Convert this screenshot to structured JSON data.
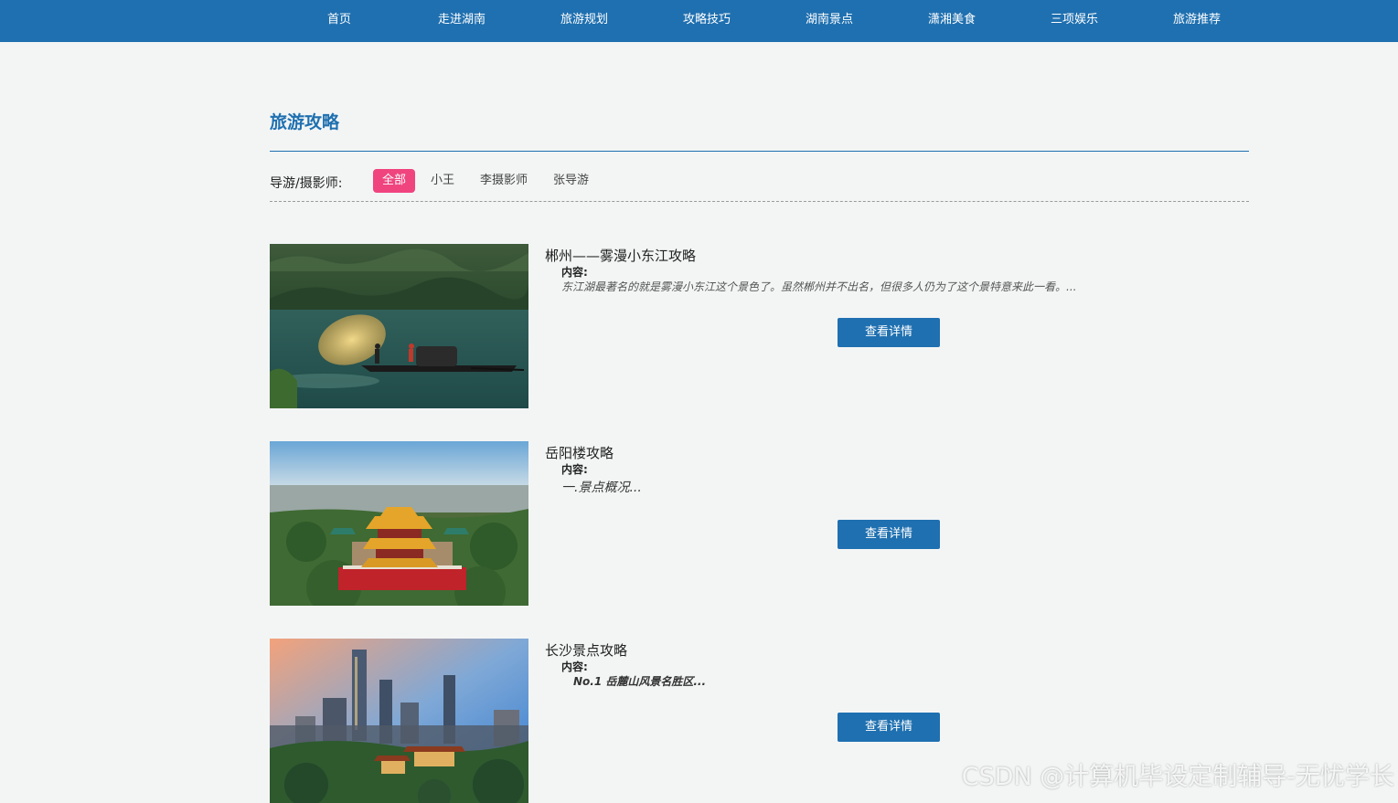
{
  "nav": {
    "items": [
      "首页",
      "走进湖南",
      "旅游规划",
      "攻略技巧",
      "湖南景点",
      "潇湘美食",
      "三项娱乐",
      "旅游推荐"
    ]
  },
  "section": {
    "title": "旅游攻略"
  },
  "filter": {
    "label": "导游/摄影师:",
    "options": [
      "全部",
      "小王",
      "李摄影师",
      "张导游"
    ],
    "active": "全部"
  },
  "articles": [
    {
      "title": "郴州——雾漫小东江攻略",
      "content_label": "内容:",
      "excerpt": "东江湖最著名的就是雾漫小东江这个景色了。虽然郴州并不出名，但很多人仍为了这个景特意来此一看。...",
      "button": "查看详情",
      "image_icon": "lake-fisherman-photo"
    },
    {
      "title": "岳阳楼攻略",
      "content_label": "内容:",
      "excerpt": "一.景点概况...",
      "button": "查看详情",
      "image_icon": "yueyang-tower-photo"
    },
    {
      "title": "长沙景点攻略",
      "content_label": "内容:",
      "excerpt": "No.1 岳麓山风景名胜区...",
      "button": "查看详情",
      "image_icon": "changsha-skyline-photo"
    }
  ],
  "watermark": "CSDN @计算机毕设定制辅导-无忧学长",
  "colors": {
    "primary": "#1f70b0",
    "accent": "#f0447f",
    "background": "#f3f5f5"
  }
}
